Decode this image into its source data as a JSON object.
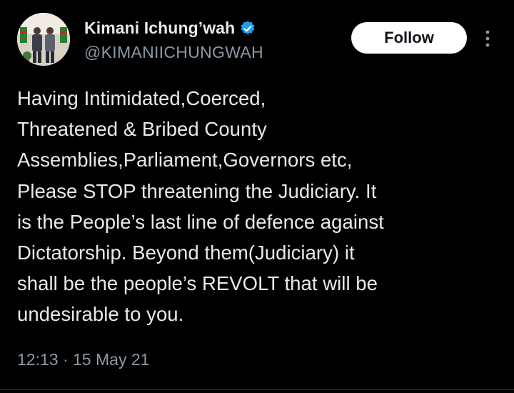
{
  "tweet": {
    "author": {
      "display_name": "Kimani Ichung’wah",
      "handle": "@KIMANIICHUNGWAH",
      "verified": true
    },
    "follow_label": "Follow",
    "text": "Having Intimidated,Coerced,\nThreatened & Bribed County\nAssemblies,Parliament,Governors etc,\nPlease STOP threatening the Judiciary. It\nis the People’s last line of defence against\nDictatorship. Beyond them(Judiciary) it\nshall be the people’s REVOLT that will be\nundesirable to you.",
    "time": "12:13",
    "separator": "·",
    "date": "15 May 21"
  },
  "icons": {
    "verified": "verified-badge-icon",
    "more": "more-options-icon",
    "avatar": "profile-photo"
  },
  "colors": {
    "background": "#000000",
    "text_primary": "#e7e9ea",
    "text_secondary": "#8b98a5",
    "verified_blue": "#1d9bf0",
    "follow_bg": "#ffffff"
  }
}
